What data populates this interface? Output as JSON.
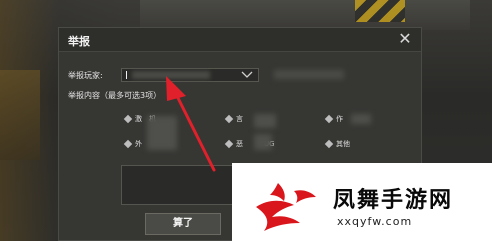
{
  "dialog": {
    "title": "举报",
    "close_symbol": "✕",
    "player_label": "举报玩家:",
    "content_label": "举报内容（最多可选3项）",
    "options": [
      {
        "label": "激　机"
      },
      {
        "label": "言"
      },
      {
        "label": "作"
      },
      {
        "label": "外"
      },
      {
        "label": "恶　　　UG"
      },
      {
        "label": "其他"
      }
    ],
    "submit_label": "算了"
  },
  "watermark": {
    "name": "凤舞手游网",
    "url": "xxqyfw.com"
  },
  "colors": {
    "arrow": "#e0202a",
    "logo_red": "#d9161c"
  },
  "icons": {
    "close": "close-icon",
    "dropdown": "chevron-down-icon",
    "option_marker": "diamond-radio-icon"
  }
}
